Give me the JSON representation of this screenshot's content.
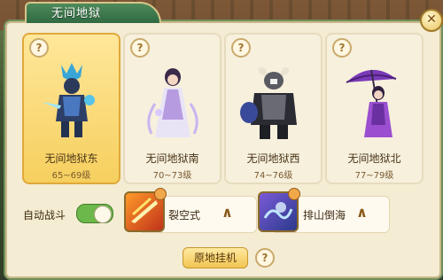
{
  "window": {
    "title": "无间地狱",
    "close_glyph": "✕"
  },
  "dungeons": [
    {
      "name": "无间地狱东",
      "level": "65~69级",
      "selected": true,
      "help": "?"
    },
    {
      "name": "无间地狱南",
      "level": "70~73级",
      "selected": false,
      "help": "?"
    },
    {
      "name": "无间地狱西",
      "level": "74~76级",
      "selected": false,
      "help": "?"
    },
    {
      "name": "无间地狱北",
      "level": "77~79级",
      "selected": false,
      "help": "?"
    }
  ],
  "auto_battle": {
    "label": "自动战斗",
    "on": true
  },
  "skills": [
    {
      "name": "裂空式",
      "icon": "slash-fire-icon",
      "chevron": "∧"
    },
    {
      "name": "排山倒海",
      "icon": "ghost-wave-icon",
      "chevron": "∧"
    }
  ],
  "bottom": {
    "button_label": "原地挂机",
    "help": "?"
  },
  "colors": {
    "accent": "#f6cf5e",
    "panel": "#f4ecd3",
    "toggle_on": "#6cb84a"
  }
}
